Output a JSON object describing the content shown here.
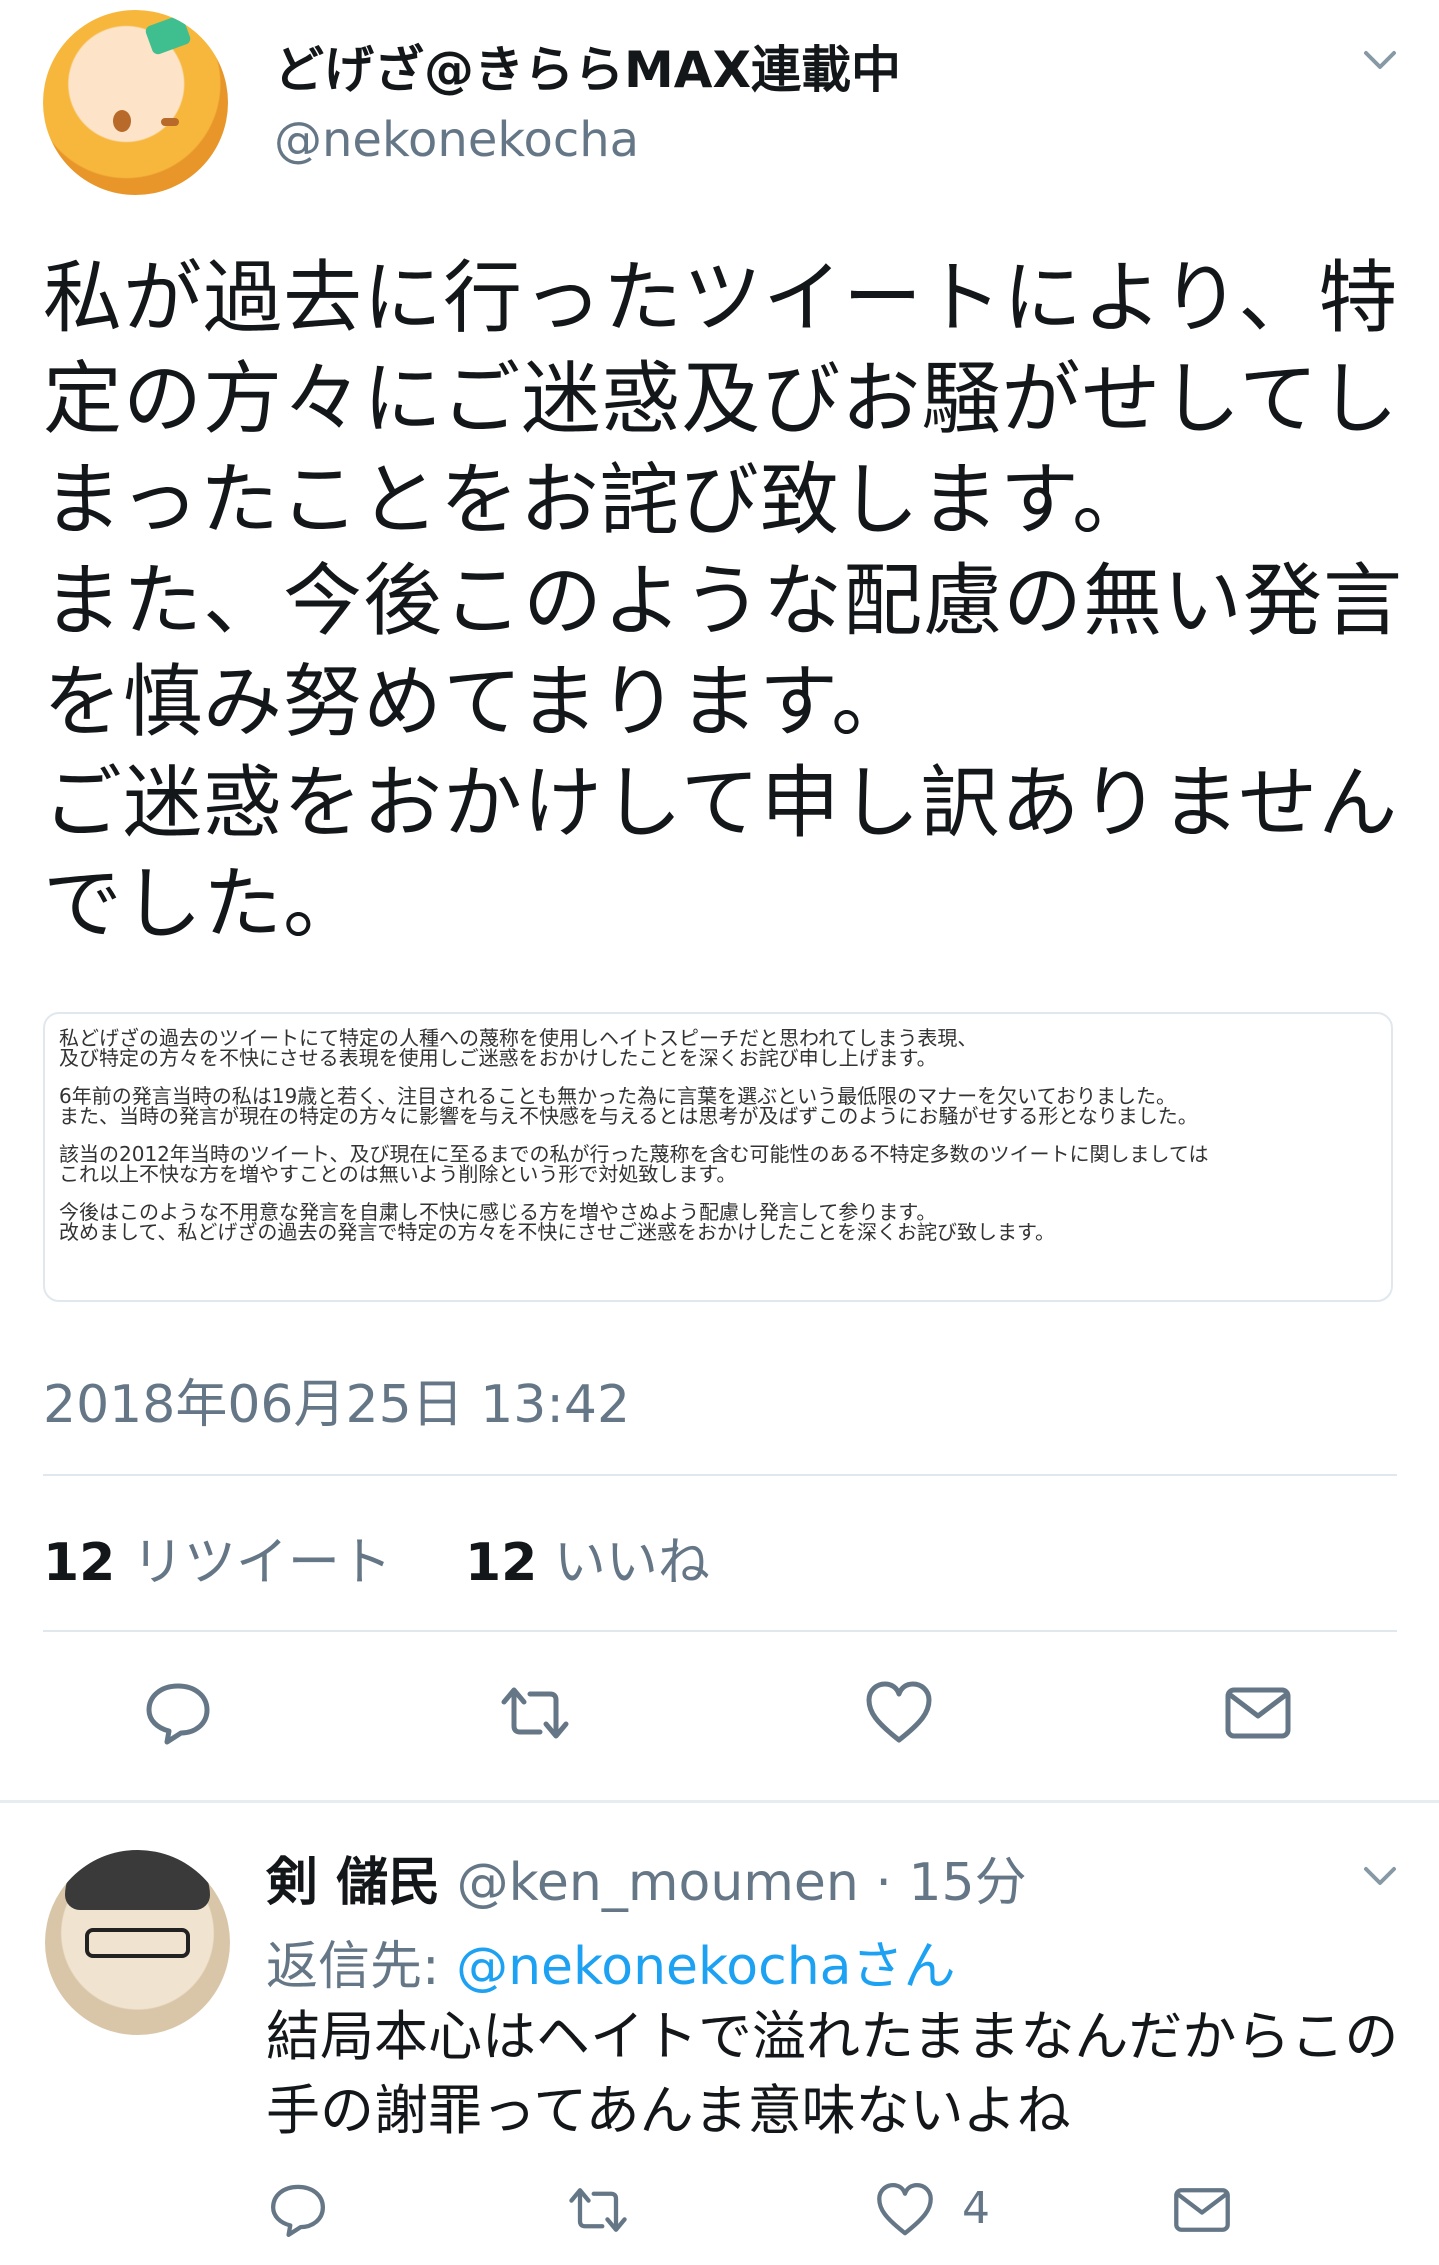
{
  "tweet": {
    "display_name": "どげざ@きららMAX連載中",
    "handle": "@nekonekocha",
    "text_lines": [
      "私が過去に行ったツイートにより、特",
      "定の方々にご迷惑及びお騒がせしてし",
      "まったことをお詫び致します。",
      "また、今後このような配慮の無い発言",
      "を慎み努めてまります。",
      "ご迷惑をおかけして申し訳ありません",
      "でした。"
    ],
    "attachment_paragraphs": [
      [
        "私どげざの過去のツイートにて特定の人種への蔑称を使用しヘイトスピーチだと思われてしまう表現、",
        "及び特定の方々を不快にさせる表現を使用しご迷惑をおかけしたことを深くお詫び申し上げます。"
      ],
      [
        "6年前の発言当時の私は19歳と若く、注目されることも無かった為に言葉を選ぶという最低限のマナーを欠いておりました。",
        "また、当時の発言が現在の特定の方々に影響を与え不快感を与えるとは思考が及ばずこのようにお騒がせする形となりました。"
      ],
      [
        "該当の2012年当時のツイート、及び現在に至るまでの私が行った蔑称を含む可能性のある不特定多数のツイートに関しましては",
        "これ以上不快な方を増やすことのは無いよう削除という形で対処致します。"
      ],
      [
        "今後はこのような不用意な発言を自粛し不快に感じる方を増やさぬよう配慮し発言して参ります。",
        "改めまして、私どげざの過去の発言で特定の方々を不快にさせご迷惑をおかけしたことを深くお詫び致します。"
      ]
    ],
    "timestamp": "2018年06月25日 13:42",
    "retweet_count": "12",
    "retweet_label": "リツイート",
    "like_count": "12",
    "like_label": "いいね"
  },
  "reply": {
    "display_name": "剣 儲民",
    "meta": "@ken_moumen · 15分",
    "reply_to_prefix": "返信先: ",
    "reply_to_mention": "@nekonekochaさん",
    "text_lines": [
      "結局本心はヘイトで溢れたままなんだからこの",
      "手の謝罪ってあんま意味ないよね"
    ],
    "like_count": "4"
  },
  "icons": [
    "chevron-down-icon",
    "reply-icon",
    "retweet-icon",
    "heart-icon",
    "envelope-icon"
  ],
  "colors": {
    "text": "#14171a",
    "secondary": "#657786",
    "link": "#1da1f2",
    "divider": "#e1e8ed"
  }
}
